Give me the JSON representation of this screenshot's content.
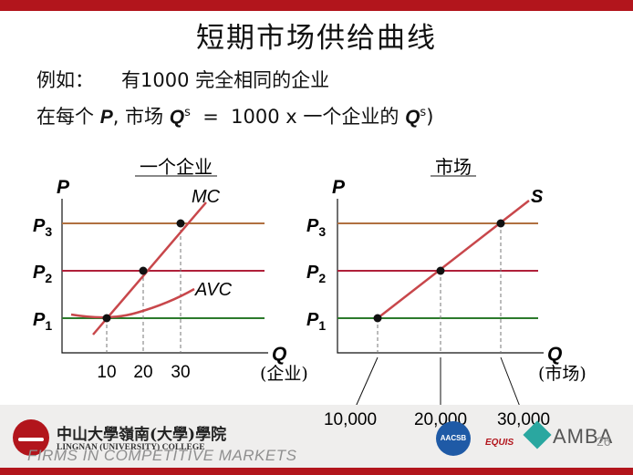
{
  "slide": {
    "title": "短期市场供给曲线",
    "line1_prefix": "例如：",
    "line1_text": "有1000 完全相同的企业",
    "line2_a": "在每个 ",
    "line2_p": "P",
    "line2_b": ", 市场 ",
    "line2_q": "Q",
    "line2_s": "s",
    "line2_c": "  =  1000 x 一个企业的 ",
    "line2_q2": "Q",
    "line2_s2": "s",
    "line2_d": ")"
  },
  "charts": {
    "firm": {
      "heading": "一个企业",
      "y_label": "P",
      "x_label": "Q",
      "x_unit": "(企业)",
      "mc_label": "MC",
      "avc_label": "AVC",
      "price_labels": [
        "P",
        "P",
        "P"
      ],
      "price_subs": [
        "1",
        "2",
        "3"
      ],
      "x_ticks": [
        "10",
        "20",
        "30"
      ]
    },
    "market": {
      "heading": "市场",
      "y_label": "P",
      "x_label": "Q",
      "x_unit": "(市场)",
      "s_label": "S",
      "price_labels": [
        "P",
        "P",
        "P"
      ],
      "price_subs": [
        "1",
        "2",
        "3"
      ],
      "x_ticks": [
        "10,000",
        "20,000",
        "30,000"
      ]
    }
  },
  "chart_data": [
    {
      "type": "line",
      "title": "一个企业",
      "xlabel": "Q",
      "ylabel": "P",
      "points": [
        {
          "q": 10,
          "p": "P1"
        },
        {
          "q": 20,
          "p": "P2"
        },
        {
          "q": 30,
          "p": "P3"
        }
      ],
      "series": [
        {
          "name": "MC"
        },
        {
          "name": "AVC"
        }
      ]
    },
    {
      "type": "line",
      "title": "市场",
      "xlabel": "Q",
      "ylabel": "P",
      "points": [
        {
          "q": 10000,
          "p": "P1"
        },
        {
          "q": 20000,
          "p": "P2"
        },
        {
          "q": 30000,
          "p": "P3"
        }
      ],
      "series": [
        {
          "name": "S"
        }
      ]
    }
  ],
  "colors": {
    "brand_red": "#b2151c",
    "price_line_p3": "#b07040",
    "price_line_p2": "#b0203a",
    "price_line_p1": "#2b7a2b",
    "curve": "#c8474b"
  },
  "footer": {
    "school_cn": "中山大學嶺南(大學)學院",
    "school_en": "LINGNAN (UNIVERSITY) COLLEGE",
    "course": "FIRMS IN COMPETITIVE MARKETS",
    "page": "26",
    "aacsb": "AACSB",
    "equis": "EQUIS",
    "amba": "AMBA"
  }
}
